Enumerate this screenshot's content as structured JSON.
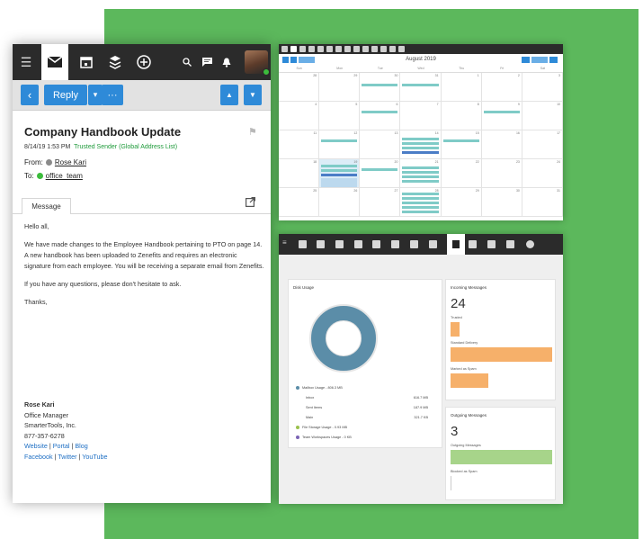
{
  "colors": {
    "accent": "#2e8ad8",
    "trusted": "#1e9a3a",
    "backdrop": "#5cb85c",
    "toolbar": "#2b2b2b"
  },
  "toolbar": {
    "icons": [
      "menu-icon",
      "mail-icon",
      "calendar-icon",
      "layers-icon",
      "add-icon",
      "search-icon",
      "chat-icon",
      "bell-icon"
    ]
  },
  "actions": {
    "reply": "Reply",
    "more": "···",
    "prev": "▲",
    "next": "▼",
    "back": "‹",
    "reply_menu": "▾"
  },
  "message": {
    "subject": "Company Handbook Update",
    "date": "8/14/19 1:53 PM",
    "trusted": "Trusted Sender (Global Address List)",
    "from_label": "From:",
    "from_name": "Rose Kari",
    "to_label": "To:",
    "to_name": "office_team",
    "tab": "Message",
    "body": [
      "Hello all,",
      "We have made changes to the Employee Handbook pertaining to PTO on page 14.  A new handbook has been uploaded to Zenefits and requires an electronic signature from each employee.  You will be receiving a separate email from Zenefits.",
      "If you have any questions, please don't hesitate to ask.",
      "Thanks,"
    ],
    "signature": {
      "name": "Rose Kari",
      "title": "Office Manager",
      "company": "SmarterTools, Inc.",
      "phone": "877-357-6278",
      "links1": [
        "Website",
        "Portal",
        "Blog"
      ],
      "links2": [
        "Facebook",
        "Twitter",
        "YouTube"
      ],
      "sep": " | "
    }
  },
  "calendar": {
    "title": "August 2019",
    "days": [
      "Sun",
      "Mon",
      "Tue",
      "Wed",
      "Thu",
      "Fri",
      "Sat"
    ],
    "weeks": [
      [
        "28",
        "29",
        "30",
        "31",
        "1",
        "2",
        "3"
      ],
      [
        "4",
        "5",
        "6",
        "7",
        "8",
        "9",
        "10"
      ],
      [
        "11",
        "12",
        "13",
        "14",
        "15",
        "16",
        "17"
      ],
      [
        "18",
        "19",
        "20",
        "21",
        "22",
        "23",
        "24"
      ],
      [
        "25",
        "26",
        "27",
        "28",
        "29",
        "30",
        "31"
      ]
    ]
  },
  "dashboard": {
    "disk": {
      "title": "Disk Usage",
      "mailbox": "Mailbox Usage - 806.3 MB",
      "rows": [
        [
          "Inbox",
          "616.7 MB"
        ],
        [
          "Sent Items",
          "187.9 MB"
        ],
        [
          "Main",
          "321.7 KB"
        ]
      ],
      "file": "File Storage Usage - 0.93 MB",
      "team": "Team Workspaces Usage - 0 KB"
    },
    "incoming": {
      "title": "Incoming Messages",
      "count": "24",
      "labels": [
        "Trusted",
        "Standard Delivery",
        "Marked as Spam"
      ],
      "fractions": [
        0.09,
        1.0,
        0.37
      ]
    },
    "outgoing": {
      "title": "Outgoing Messages",
      "count": "3",
      "labels": [
        "Outgoing Messages",
        "Blocked as Spam"
      ],
      "fractions": [
        1.0,
        0.0
      ]
    }
  }
}
